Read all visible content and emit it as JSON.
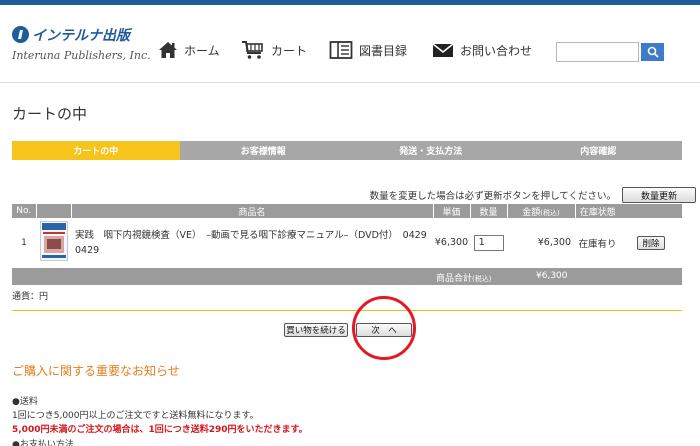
{
  "header": {
    "logo_jp": "インテルナ出版",
    "logo_en": "Interuna Publishers, Inc.",
    "nav": [
      {
        "label": "ホーム",
        "icon": "home-icon"
      },
      {
        "label": "カート",
        "icon": "cart-icon"
      },
      {
        "label": "図書目録",
        "icon": "book-catalog-icon"
      },
      {
        "label": "お問い合わせ",
        "icon": "mail-icon"
      }
    ],
    "search": {
      "value": "",
      "placeholder": ""
    }
  },
  "page_title": "カートの中",
  "steps": [
    {
      "label": "カートの中",
      "active": true
    },
    {
      "label": "お客様情報",
      "active": false
    },
    {
      "label": "発送・支払方法",
      "active": false
    },
    {
      "label": "内容確認",
      "active": false
    }
  ],
  "cart": {
    "notice": "数量を変更した場合は必ず更新ボタンを押してください。",
    "update_button": "数量更新",
    "columns": {
      "no": "No.",
      "product": "商品名",
      "unit_price": "単価",
      "quantity": "数量",
      "amount": "金額",
      "amount_tax": "(税込)",
      "stock": "在庫状態"
    },
    "items": [
      {
        "no": "1",
        "name": "実践　咽下内視鏡検査（VE）　–動画で見る咽下診療マニュアル–（DVD付）　0429",
        "code": "0429",
        "unit_price": "¥6,300",
        "quantity": "1",
        "amount": "¥6,300",
        "stock": "在庫有り",
        "delete_button": "削除"
      }
    ],
    "total_label": "商品合計",
    "total_tax": "(税込)",
    "total_value": "¥6,300",
    "currency_label": "通貨：円"
  },
  "actions": {
    "continue_button": "買い物を続ける",
    "next_button": "次　へ"
  },
  "important": {
    "title": "ご購入に関する重要なお知らせ",
    "shipping_heading": "●送料",
    "shipping_line1": "1回につき5,000円以上のご注文ですと送料無料になります。",
    "shipping_line2": "5,000円未満のご注文の場合は、1回につき送料290円をいただきます。",
    "payment_heading": "●お支払い方法"
  },
  "colors": {
    "brand_blue": "#1f5c9c",
    "step_active": "#f7c41b",
    "step_inactive": "#a7a7a7",
    "table_header": "#9b9b9b",
    "notice_orange": "#e57d1c",
    "warning_red": "#d3161d",
    "annotation_circle": "#e01b24"
  }
}
